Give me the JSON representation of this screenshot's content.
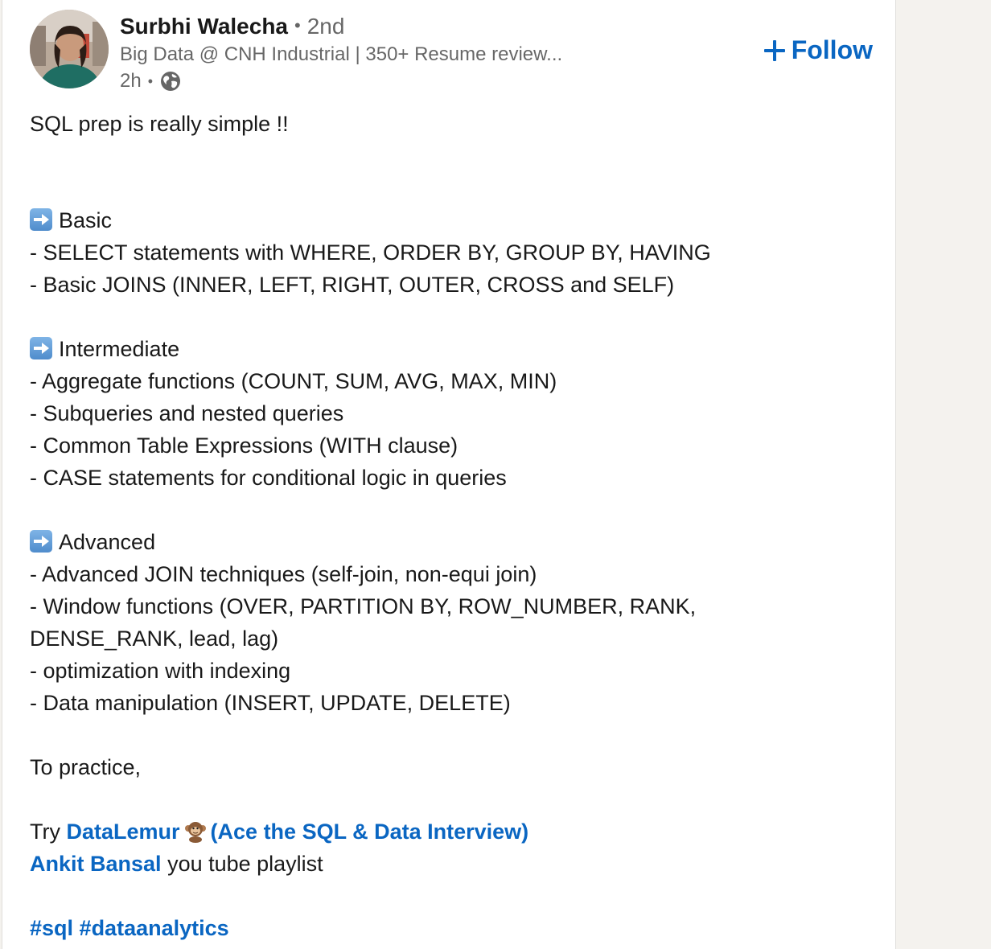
{
  "author": {
    "name": "Surbhi Walecha",
    "separator": "•",
    "degree": "2nd",
    "headline": "Big Data @ CNH Industrial | 350+ Resume review...",
    "time": "2h",
    "time_separator": "•",
    "visibility_icon": "globe-icon"
  },
  "follow_button": {
    "label": "Follow",
    "icon": "plus-icon",
    "color": "#0a66c2"
  },
  "post": {
    "intro": "SQL prep is really simple !!",
    "sections": [
      {
        "heading": "Basic",
        "items": [
          "- SELECT statements with WHERE, ORDER BY, GROUP BY, HAVING",
          "- Basic JOINS (INNER, LEFT, RIGHT, OUTER, CROSS and SELF)"
        ]
      },
      {
        "heading": "Intermediate",
        "items": [
          "- Aggregate functions (COUNT, SUM, AVG, MAX, MIN)",
          "- Subqueries and nested queries",
          "- Common Table Expressions (WITH clause)",
          "- CASE statements for conditional logic in queries"
        ]
      },
      {
        "heading": "Advanced",
        "items": [
          "- Advanced JOIN techniques (self-join, non-equi join)",
          "- Window functions (OVER, PARTITION BY, ROW_NUMBER, RANK,",
          "DENSE_RANK, lead, lag)",
          "- optimization with indexing",
          "- Data manipulation (INSERT, UPDATE, DELETE)"
        ]
      }
    ],
    "practice_intro": "To practice,",
    "try_prefix": "Try",
    "datalemur_link": "DataLemur",
    "datalemur_emoji": "monkey-emoji",
    "datalemur_tagline": "(Ace the SQL & Data Interview)",
    "ankit_link": "Ankit Bansal",
    "ankit_suffix": "you tube playlist",
    "hashtags": [
      "#sql",
      "#dataanalytics"
    ]
  },
  "colors": {
    "link": "#0a66c2",
    "text": "#191919",
    "muted": "#666666",
    "arrow_emoji": "#5b9bd5"
  }
}
